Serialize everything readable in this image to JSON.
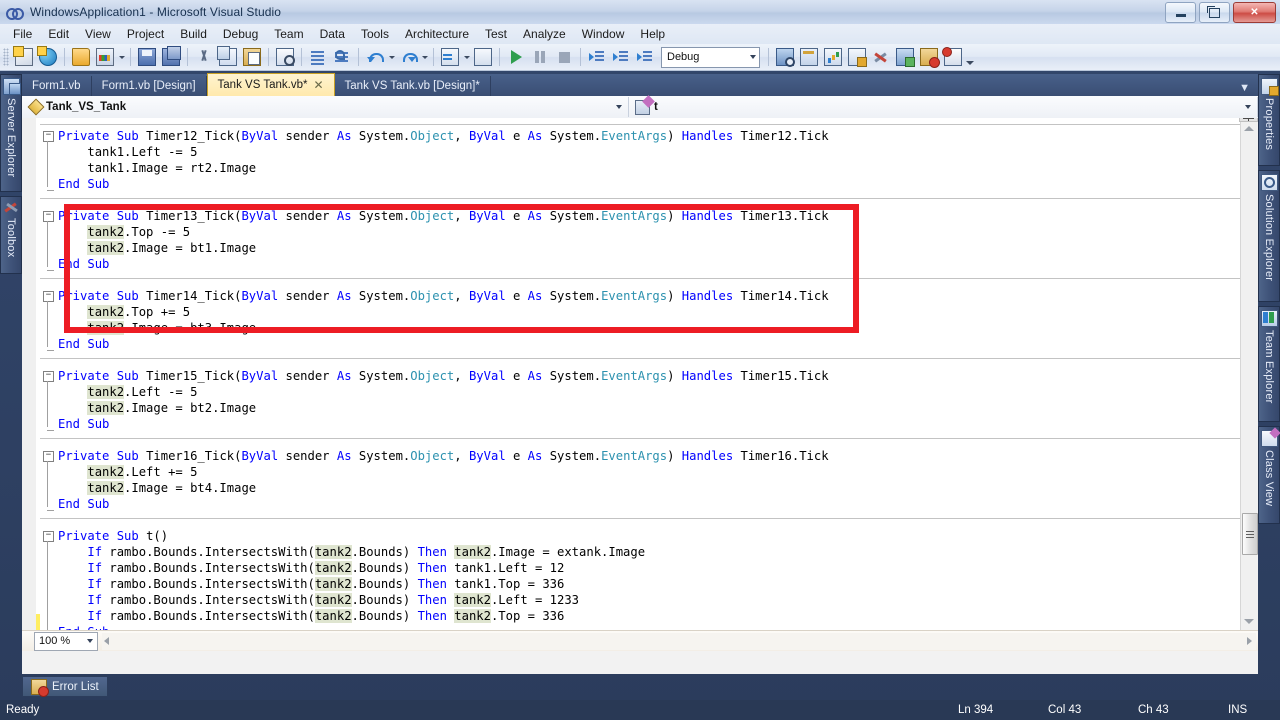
{
  "window": {
    "title": "WindowsApplication1 - Microsoft Visual Studio",
    "logo_icon": "visual-studio-logo-icon",
    "minimize_label": "Minimize",
    "maximize_label": "Restore",
    "close_label": "Close"
  },
  "menu": {
    "items": [
      "File",
      "Edit",
      "View",
      "Project",
      "Build",
      "Debug",
      "Team",
      "Data",
      "Tools",
      "Architecture",
      "Test",
      "Analyze",
      "Window",
      "Help"
    ]
  },
  "toolbar": {
    "buttons": [
      {
        "name": "new-project-icon",
        "cls": "ic-doc",
        "tip": "New Project"
      },
      {
        "name": "new-web-site-icon",
        "cls": "ic-globe",
        "tip": "New Web Site"
      },
      {
        "name": "open-file-icon",
        "cls": "ic-folder",
        "tip": "Open File"
      },
      {
        "name": "add-new-item-icon",
        "cls": "ic-palette",
        "tip": "Add New Item"
      },
      {
        "name": "save-icon",
        "cls": "ic-save",
        "tip": "Save"
      },
      {
        "name": "save-all-icon",
        "cls": "ic-saveall",
        "tip": "Save All"
      },
      {
        "name": "cut-icon",
        "cls": "ic-cut",
        "tip": "Cut"
      },
      {
        "name": "copy-icon",
        "cls": "ic-copy",
        "tip": "Copy"
      },
      {
        "name": "paste-icon",
        "cls": "ic-paste",
        "tip": "Paste"
      },
      {
        "name": "find-icon",
        "cls": "ic-find",
        "tip": "Find in Files"
      },
      {
        "name": "comment-block-icon",
        "cls": "ic-indent",
        "tip": "Comment Block"
      },
      {
        "name": "uncomment-block-icon",
        "cls": "ic-comment",
        "tip": "Uncomment Block"
      },
      {
        "name": "undo-icon",
        "cls": "ic-undo",
        "tip": "Undo"
      },
      {
        "name": "redo-icon",
        "cls": "ic-redo",
        "tip": "Redo"
      },
      {
        "name": "navigate-backward-icon",
        "cls": "ic-nav",
        "tip": "Navigate Backward"
      },
      {
        "name": "navigate-forward-icon",
        "cls": "ic-nav2",
        "tip": "Navigate Forward"
      },
      {
        "name": "start-debugging-icon",
        "cls": "ic-play",
        "tip": "Start Debugging"
      },
      {
        "name": "pause-icon",
        "cls": "ic-pause",
        "tip": "Break All"
      },
      {
        "name": "stop-icon",
        "cls": "ic-stop",
        "tip": "Stop Debugging"
      },
      {
        "name": "step-into-icon",
        "cls": "ic-step",
        "tip": "Step Into"
      },
      {
        "name": "step-over-icon",
        "cls": "ic-step",
        "tip": "Step Over"
      },
      {
        "name": "step-out-icon",
        "cls": "ic-step",
        "tip": "Step Out"
      }
    ],
    "config_value": "Debug",
    "right_buttons": [
      {
        "name": "find-in-files-icon",
        "cls": "ic-magn",
        "tip": "Find in Files"
      },
      {
        "name": "solution-explorer-icon",
        "cls": "ic-win",
        "tip": "Solution Explorer"
      },
      {
        "name": "object-browser-icon",
        "cls": "ic-chart",
        "tip": "Object Browser"
      },
      {
        "name": "properties-window-icon",
        "cls": "ic-props",
        "tip": "Properties Window"
      },
      {
        "name": "toolbox-icon",
        "cls": "ic-tools",
        "tip": "Toolbox"
      },
      {
        "name": "class-view-icon",
        "cls": "ic-obj",
        "tip": "Class View"
      },
      {
        "name": "error-list-icon",
        "cls": "ic-errlist",
        "tip": "Error List"
      },
      {
        "name": "output-window-icon",
        "cls": "ic-outwin",
        "tip": "Output Window"
      }
    ],
    "overflow_label": "Toolbar Options"
  },
  "dock_left": [
    {
      "label": "Server Explorer",
      "icon": "server-explorer-icon",
      "cls": "di-server",
      "height": 118
    },
    {
      "label": "Toolbox",
      "icon": "toolbox-icon",
      "cls": "di-toolbox",
      "height": 78
    }
  ],
  "dock_right": [
    {
      "label": "Properties",
      "icon": "properties-icon",
      "cls": "di-props",
      "height": 92
    },
    {
      "label": "Solution Explorer",
      "icon": "solution-explorer-icon",
      "cls": "di-solution",
      "height": 132
    },
    {
      "label": "Team Explorer",
      "icon": "team-explorer-icon",
      "cls": "di-team",
      "height": 116
    },
    {
      "label": "Class View",
      "icon": "class-view-icon",
      "cls": "di-class",
      "height": 98
    }
  ],
  "document_tabs": {
    "items": [
      {
        "label": "Form1.vb",
        "active": false,
        "closable": false
      },
      {
        "label": "Form1.vb [Design]",
        "active": false,
        "closable": false
      },
      {
        "label": "Tank VS Tank.vb*",
        "active": true,
        "closable": true
      },
      {
        "label": "Tank VS Tank.vb [Design]*",
        "active": false,
        "closable": false
      }
    ],
    "close_glyph": "✕",
    "overflow_glyph": "▼"
  },
  "navigation_bar": {
    "class_value": "Tank_VS_Tank",
    "class_icon": "class-icon",
    "member_value": "t",
    "member_icon": "method-private-icon"
  },
  "editor": {
    "lines": [
      {
        "indent": 1,
        "tokens": [
          {
            "t": "Private",
            "c": "kw"
          },
          {
            "t": " "
          },
          {
            "t": "Sub",
            "c": "kw"
          },
          {
            "t": " Timer12_Tick("
          },
          {
            "t": "ByVal",
            "c": "kw"
          },
          {
            "t": " sender "
          },
          {
            "t": "As",
            "c": "kw"
          },
          {
            "t": " System."
          },
          {
            "t": "Object",
            "c": "ty"
          },
          {
            "t": ", "
          },
          {
            "t": "ByVal",
            "c": "kw"
          },
          {
            "t": " e "
          },
          {
            "t": "As",
            "c": "kw"
          },
          {
            "t": " System."
          },
          {
            "t": "EventArgs",
            "c": "ty"
          },
          {
            "t": ") "
          },
          {
            "t": "Handles",
            "c": "kw"
          },
          {
            "t": " Timer12.Tick"
          }
        ]
      },
      {
        "indent": 2,
        "tokens": [
          {
            "t": "tank1.Left -= 5"
          }
        ]
      },
      {
        "indent": 2,
        "tokens": [
          {
            "t": "tank1.Image = rt2.Image"
          }
        ]
      },
      {
        "indent": 1,
        "tokens": [
          {
            "t": "End",
            "c": "kw"
          },
          {
            "t": " "
          },
          {
            "t": "Sub",
            "c": "kw"
          }
        ]
      },
      {
        "blank": true
      },
      {
        "indent": 1,
        "tokens": [
          {
            "t": "Private",
            "c": "kw"
          },
          {
            "t": " "
          },
          {
            "t": "Sub",
            "c": "kw"
          },
          {
            "t": " Timer13_Tick("
          },
          {
            "t": "ByVal",
            "c": "kw"
          },
          {
            "t": " sender "
          },
          {
            "t": "As",
            "c": "kw"
          },
          {
            "t": " System."
          },
          {
            "t": "Object",
            "c": "ty"
          },
          {
            "t": ", "
          },
          {
            "t": "ByVal",
            "c": "kw"
          },
          {
            "t": " e "
          },
          {
            "t": "As",
            "c": "kw"
          },
          {
            "t": " System."
          },
          {
            "t": "EventArgs",
            "c": "ty"
          },
          {
            "t": ") "
          },
          {
            "t": "Handles",
            "c": "kw"
          },
          {
            "t": " Timer13.Tick"
          }
        ]
      },
      {
        "indent": 2,
        "tokens": [
          {
            "t": "tank2",
            "c": "hl"
          },
          {
            "t": ".Top -= 5"
          }
        ]
      },
      {
        "indent": 2,
        "tokens": [
          {
            "t": "tank2",
            "c": "hl"
          },
          {
            "t": ".Image = bt1.Image"
          }
        ]
      },
      {
        "indent": 1,
        "tokens": [
          {
            "t": "End",
            "c": "kw"
          },
          {
            "t": " "
          },
          {
            "t": "Sub",
            "c": "kw"
          }
        ]
      },
      {
        "blank": true
      },
      {
        "indent": 1,
        "tokens": [
          {
            "t": "Private",
            "c": "kw"
          },
          {
            "t": " "
          },
          {
            "t": "Sub",
            "c": "kw"
          },
          {
            "t": " Timer14_Tick("
          },
          {
            "t": "ByVal",
            "c": "kw"
          },
          {
            "t": " sender "
          },
          {
            "t": "As",
            "c": "kw"
          },
          {
            "t": " System."
          },
          {
            "t": "Object",
            "c": "ty"
          },
          {
            "t": ", "
          },
          {
            "t": "ByVal",
            "c": "kw"
          },
          {
            "t": " e "
          },
          {
            "t": "As",
            "c": "kw"
          },
          {
            "t": " System."
          },
          {
            "t": "EventArgs",
            "c": "ty"
          },
          {
            "t": ") "
          },
          {
            "t": "Handles",
            "c": "kw"
          },
          {
            "t": " Timer14.Tick"
          }
        ]
      },
      {
        "indent": 2,
        "tokens": [
          {
            "t": "tank2",
            "c": "hl"
          },
          {
            "t": ".Top += 5"
          }
        ]
      },
      {
        "indent": 2,
        "tokens": [
          {
            "t": "tank2",
            "c": "hl"
          },
          {
            "t": ".Image = bt3.Image"
          }
        ]
      },
      {
        "indent": 1,
        "tokens": [
          {
            "t": "End",
            "c": "kw"
          },
          {
            "t": " "
          },
          {
            "t": "Sub",
            "c": "kw"
          }
        ]
      },
      {
        "blank": true
      },
      {
        "indent": 1,
        "tokens": [
          {
            "t": "Private",
            "c": "kw"
          },
          {
            "t": " "
          },
          {
            "t": "Sub",
            "c": "kw"
          },
          {
            "t": " Timer15_Tick("
          },
          {
            "t": "ByVal",
            "c": "kw"
          },
          {
            "t": " sender "
          },
          {
            "t": "As",
            "c": "kw"
          },
          {
            "t": " System."
          },
          {
            "t": "Object",
            "c": "ty"
          },
          {
            "t": ", "
          },
          {
            "t": "ByVal",
            "c": "kw"
          },
          {
            "t": " e "
          },
          {
            "t": "As",
            "c": "kw"
          },
          {
            "t": " System."
          },
          {
            "t": "EventArgs",
            "c": "ty"
          },
          {
            "t": ") "
          },
          {
            "t": "Handles",
            "c": "kw"
          },
          {
            "t": " Timer15.Tick"
          }
        ]
      },
      {
        "indent": 2,
        "tokens": [
          {
            "t": "tank2",
            "c": "hl"
          },
          {
            "t": ".Left -= 5"
          }
        ]
      },
      {
        "indent": 2,
        "tokens": [
          {
            "t": "tank2",
            "c": "hl"
          },
          {
            "t": ".Image = bt2.Image"
          }
        ]
      },
      {
        "indent": 1,
        "tokens": [
          {
            "t": "End",
            "c": "kw"
          },
          {
            "t": " "
          },
          {
            "t": "Sub",
            "c": "kw"
          }
        ]
      },
      {
        "blank": true
      },
      {
        "indent": 1,
        "tokens": [
          {
            "t": "Private",
            "c": "kw"
          },
          {
            "t": " "
          },
          {
            "t": "Sub",
            "c": "kw"
          },
          {
            "t": " Timer16_Tick("
          },
          {
            "t": "ByVal",
            "c": "kw"
          },
          {
            "t": " sender "
          },
          {
            "t": "As",
            "c": "kw"
          },
          {
            "t": " System."
          },
          {
            "t": "Object",
            "c": "ty"
          },
          {
            "t": ", "
          },
          {
            "t": "ByVal",
            "c": "kw"
          },
          {
            "t": " e "
          },
          {
            "t": "As",
            "c": "kw"
          },
          {
            "t": " System."
          },
          {
            "t": "EventArgs",
            "c": "ty"
          },
          {
            "t": ") "
          },
          {
            "t": "Handles",
            "c": "kw"
          },
          {
            "t": " Timer16.Tick"
          }
        ]
      },
      {
        "indent": 2,
        "tokens": [
          {
            "t": "tank2",
            "c": "hl"
          },
          {
            "t": ".Left += 5"
          }
        ]
      },
      {
        "indent": 2,
        "tokens": [
          {
            "t": "tank2",
            "c": "hl"
          },
          {
            "t": ".Image = bt4.Image"
          }
        ]
      },
      {
        "indent": 1,
        "tokens": [
          {
            "t": "End",
            "c": "kw"
          },
          {
            "t": " "
          },
          {
            "t": "Sub",
            "c": "kw"
          }
        ]
      },
      {
        "blank": true
      },
      {
        "indent": 1,
        "tokens": [
          {
            "t": "Private",
            "c": "kw"
          },
          {
            "t": " "
          },
          {
            "t": "Sub",
            "c": "kw"
          },
          {
            "t": " t()"
          }
        ]
      },
      {
        "indent": 2,
        "tokens": [
          {
            "t": "If",
            "c": "kw"
          },
          {
            "t": " rambo.Bounds.IntersectsWith("
          },
          {
            "t": "tank2",
            "c": "hl"
          },
          {
            "t": ".Bounds) "
          },
          {
            "t": "Then",
            "c": "kw"
          },
          {
            "t": " "
          },
          {
            "t": "tank2",
            "c": "hl"
          },
          {
            "t": ".Image = extank.Image"
          }
        ]
      },
      {
        "indent": 2,
        "tokens": [
          {
            "t": "If",
            "c": "kw"
          },
          {
            "t": " rambo.Bounds.IntersectsWith("
          },
          {
            "t": "tank2",
            "c": "hl"
          },
          {
            "t": ".Bounds) "
          },
          {
            "t": "Then",
            "c": "kw"
          },
          {
            "t": " tank1.Left = 12"
          }
        ]
      },
      {
        "indent": 2,
        "tokens": [
          {
            "t": "If",
            "c": "kw"
          },
          {
            "t": " rambo.Bounds.IntersectsWith("
          },
          {
            "t": "tank2",
            "c": "hl"
          },
          {
            "t": ".Bounds) "
          },
          {
            "t": "Then",
            "c": "kw"
          },
          {
            "t": " tank1.Top = 336"
          }
        ]
      },
      {
        "indent": 2,
        "tokens": [
          {
            "t": "If",
            "c": "kw"
          },
          {
            "t": " rambo.Bounds.IntersectsWith("
          },
          {
            "t": "tank2",
            "c": "hl"
          },
          {
            "t": ".Bounds) "
          },
          {
            "t": "Then",
            "c": "kw"
          },
          {
            "t": " "
          },
          {
            "t": "tank2",
            "c": "hl"
          },
          {
            "t": ".Left = 1233"
          }
        ]
      },
      {
        "indent": 2,
        "tokens": [
          {
            "t": "If",
            "c": "kw"
          },
          {
            "t": " rambo.Bounds.IntersectsWith("
          },
          {
            "t": "tank2",
            "c": "hl"
          },
          {
            "t": ".Bounds) "
          },
          {
            "t": "Then",
            "c": "kw"
          },
          {
            "t": " "
          },
          {
            "t": "tank2",
            "c": "hl"
          },
          {
            "t": ".Top = 336"
          }
        ]
      },
      {
        "indent": 1,
        "tokens": [
          {
            "t": "End",
            "c": "kw"
          },
          {
            "t": " "
          },
          {
            "t": "Sub",
            "c": "kw"
          }
        ]
      }
    ],
    "collapse_glyph": "−",
    "annotation": {
      "color": "#ed1c24",
      "name": "red-highlight-rectangle"
    }
  },
  "editor_footer": {
    "zoom_value": "100 %",
    "hscroll_name": "horizontal-scrollbar"
  },
  "error_list": {
    "label": "Error List",
    "icon": "error-list-icon"
  },
  "status": {
    "message": "Ready",
    "line": "Ln 394",
    "column": "Col 43",
    "character": "Ch 43",
    "insert_mode": "INS"
  },
  "colors": {
    "accent": "#293955",
    "keyword": "#0000ff",
    "type": "#2b91af",
    "reference_highlight": "#dfe5d0",
    "annotation_red": "#ed1c24",
    "active_tab": "#ffe9ad"
  }
}
